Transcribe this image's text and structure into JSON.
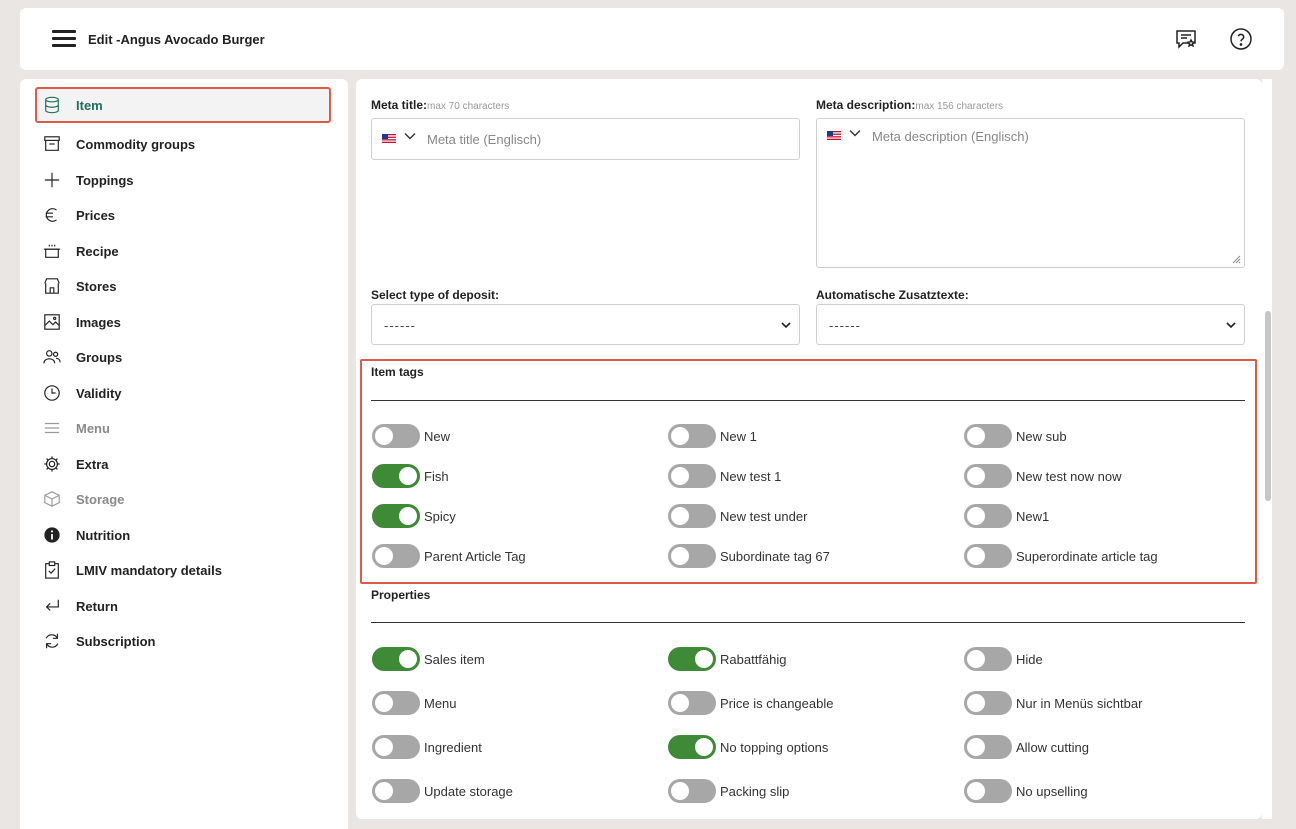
{
  "header": {
    "title": "Edit -Angus Avocado Burger",
    "icons": [
      "menu-icon",
      "feedback-icon",
      "help-icon"
    ]
  },
  "sidebar": {
    "items": [
      {
        "label": "Item",
        "icon": "database-icon",
        "state": "active"
      },
      {
        "label": "Commodity groups",
        "icon": "archive-icon",
        "state": "normal"
      },
      {
        "label": "Toppings",
        "icon": "plus-icon",
        "state": "normal"
      },
      {
        "label": "Prices",
        "icon": "euro-icon",
        "state": "normal"
      },
      {
        "label": "Recipe",
        "icon": "pot-icon",
        "state": "normal"
      },
      {
        "label": "Stores",
        "icon": "store-icon",
        "state": "normal"
      },
      {
        "label": "Images",
        "icon": "image-icon",
        "state": "normal"
      },
      {
        "label": "Groups",
        "icon": "users-icon",
        "state": "normal"
      },
      {
        "label": "Validity",
        "icon": "clock-icon",
        "state": "normal"
      },
      {
        "label": "Menu",
        "icon": "list-icon",
        "state": "disabled"
      },
      {
        "label": "Extra",
        "icon": "gear-icon",
        "state": "normal"
      },
      {
        "label": "Storage",
        "icon": "box-icon",
        "state": "disabled"
      },
      {
        "label": "Nutrition",
        "icon": "info-icon",
        "state": "normal"
      },
      {
        "label": "LMIV mandatory details",
        "icon": "clipboard-check-icon",
        "state": "normal"
      },
      {
        "label": "Return",
        "icon": "return-arrow-icon",
        "state": "normal"
      },
      {
        "label": "Subscription",
        "icon": "refresh-icon",
        "state": "normal"
      }
    ]
  },
  "form": {
    "meta_title": {
      "label": "Meta title:",
      "hint": "max 70 characters",
      "placeholder": "Meta title (Englisch)"
    },
    "meta_description": {
      "label": "Meta description:",
      "hint": "max 156 characters",
      "placeholder": "Meta description (Englisch)"
    },
    "deposit": {
      "label": "Select type of deposit:",
      "value": "------"
    },
    "zusatztexte": {
      "label": "Automatische Zusatztexte:",
      "value": "------"
    }
  },
  "item_tags": {
    "title": "Item tags",
    "tags": [
      {
        "label": "New",
        "on": false
      },
      {
        "label": "New 1",
        "on": false
      },
      {
        "label": "New sub",
        "on": false
      },
      {
        "label": "Fish",
        "on": true
      },
      {
        "label": "New test 1",
        "on": false
      },
      {
        "label": "New test now now",
        "on": false
      },
      {
        "label": "Spicy",
        "on": true
      },
      {
        "label": "New test under",
        "on": false
      },
      {
        "label": "New1",
        "on": false
      },
      {
        "label": "Parent Article Tag",
        "on": false
      },
      {
        "label": "Subordinate tag 67",
        "on": false
      },
      {
        "label": "Superordinate article tag",
        "on": false
      }
    ]
  },
  "properties": {
    "title": "Properties",
    "items": [
      {
        "label": "Sales item",
        "on": true
      },
      {
        "label": "Rabattfähig",
        "on": true
      },
      {
        "label": "Hide",
        "on": false
      },
      {
        "label": "Menu",
        "on": false
      },
      {
        "label": "Price is changeable",
        "on": false
      },
      {
        "label": "Nur in Menüs sichtbar",
        "on": false
      },
      {
        "label": "Ingredient",
        "on": false
      },
      {
        "label": "No topping options",
        "on": true
      },
      {
        "label": "Allow cutting",
        "on": false
      },
      {
        "label": "Update storage",
        "on": false
      },
      {
        "label": "Packing slip",
        "on": false
      },
      {
        "label": "No upselling",
        "on": false
      }
    ]
  },
  "colors": {
    "accent": "#1f6f5c",
    "toggle_on": "#3e8a37",
    "toggle_off": "#a7a7a7",
    "highlight": "#e05a47"
  }
}
